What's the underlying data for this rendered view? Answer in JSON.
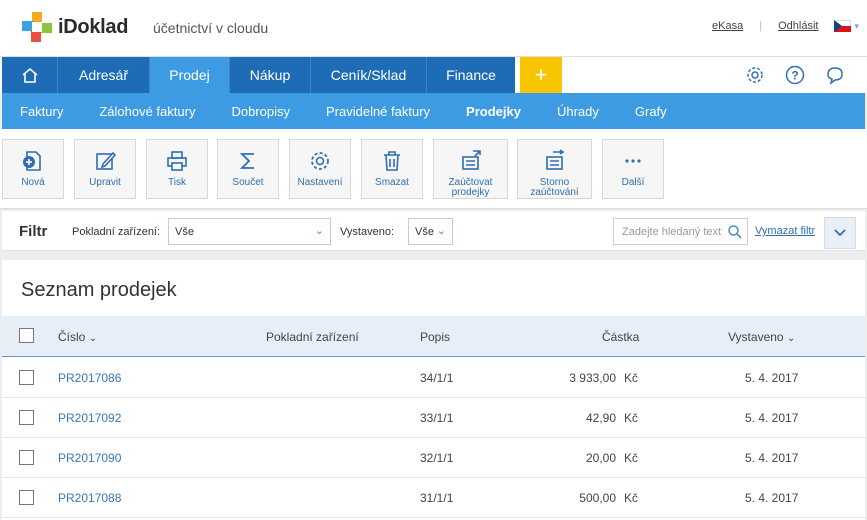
{
  "header": {
    "logo_text": "iDoklad",
    "tagline": "účetnictví v cloudu",
    "links": {
      "ekasa": "eKasa",
      "logout": "Odhlásit"
    }
  },
  "main_nav": {
    "items": [
      {
        "label": "Adresář"
      },
      {
        "label": "Prodej"
      },
      {
        "label": "Nákup"
      },
      {
        "label": "Ceník/Sklad"
      },
      {
        "label": "Finance"
      }
    ],
    "active": "Prodej",
    "add_label": "+"
  },
  "sub_nav": {
    "items": [
      {
        "label": "Faktury"
      },
      {
        "label": "Zálohové faktury"
      },
      {
        "label": "Dobropisy"
      },
      {
        "label": "Pravidelné faktury"
      },
      {
        "label": "Prodejky"
      },
      {
        "label": "Úhrady"
      },
      {
        "label": "Grafy"
      }
    ],
    "active": "Prodejky"
  },
  "toolbar": {
    "buttons": [
      {
        "label": "Nová",
        "icon": "new-document-icon"
      },
      {
        "label": "Upravit",
        "icon": "edit-icon"
      },
      {
        "label": "Tisk",
        "icon": "print-icon"
      },
      {
        "label": "Součet",
        "icon": "sum-icon"
      },
      {
        "label": "Nastavení",
        "icon": "gear-icon"
      },
      {
        "label": "Smazat",
        "icon": "trash-icon"
      },
      {
        "label": "Zaúčtovat prodejky",
        "icon": "post-icon"
      },
      {
        "label": "Storno zaúčtování",
        "icon": "cancel-posting-icon"
      },
      {
        "label": "Další",
        "icon": "more-icon"
      }
    ]
  },
  "filter": {
    "title": "Filtr",
    "device_label": "Pokladní zařízení:",
    "device_value": "Vše",
    "issued_label": "Vystaveno:",
    "issued_value": "Vše",
    "search_placeholder": "Zadejte hledaný text",
    "clear_label": "Vymazat filtr"
  },
  "list": {
    "title": "Seznam prodejek",
    "columns": {
      "number": "Číslo",
      "device": "Pokladní zařízení",
      "description": "Popis",
      "amount": "Částka",
      "issued": "Vystaveno"
    },
    "rows": [
      {
        "number": "PR2017086",
        "device": "",
        "description": "34/1/1",
        "amount": "3 933,00",
        "currency": "Kč",
        "issued": "5. 4. 2017"
      },
      {
        "number": "PR2017092",
        "device": "",
        "description": "33/1/1",
        "amount": "42,90",
        "currency": "Kč",
        "issued": "5. 4. 2017"
      },
      {
        "number": "PR2017090",
        "device": "",
        "description": "32/1/1",
        "amount": "20,00",
        "currency": "Kč",
        "issued": "5. 4. 2017"
      },
      {
        "number": "PR2017088",
        "device": "",
        "description": "31/1/1",
        "amount": "500,00",
        "currency": "Kč",
        "issued": "5. 4. 2017"
      }
    ]
  },
  "colors": {
    "nav_dark": "#1e6cb5",
    "nav_light": "#3d9be4",
    "accent_yellow": "#f9c400",
    "link_blue": "#2f6fb0"
  }
}
